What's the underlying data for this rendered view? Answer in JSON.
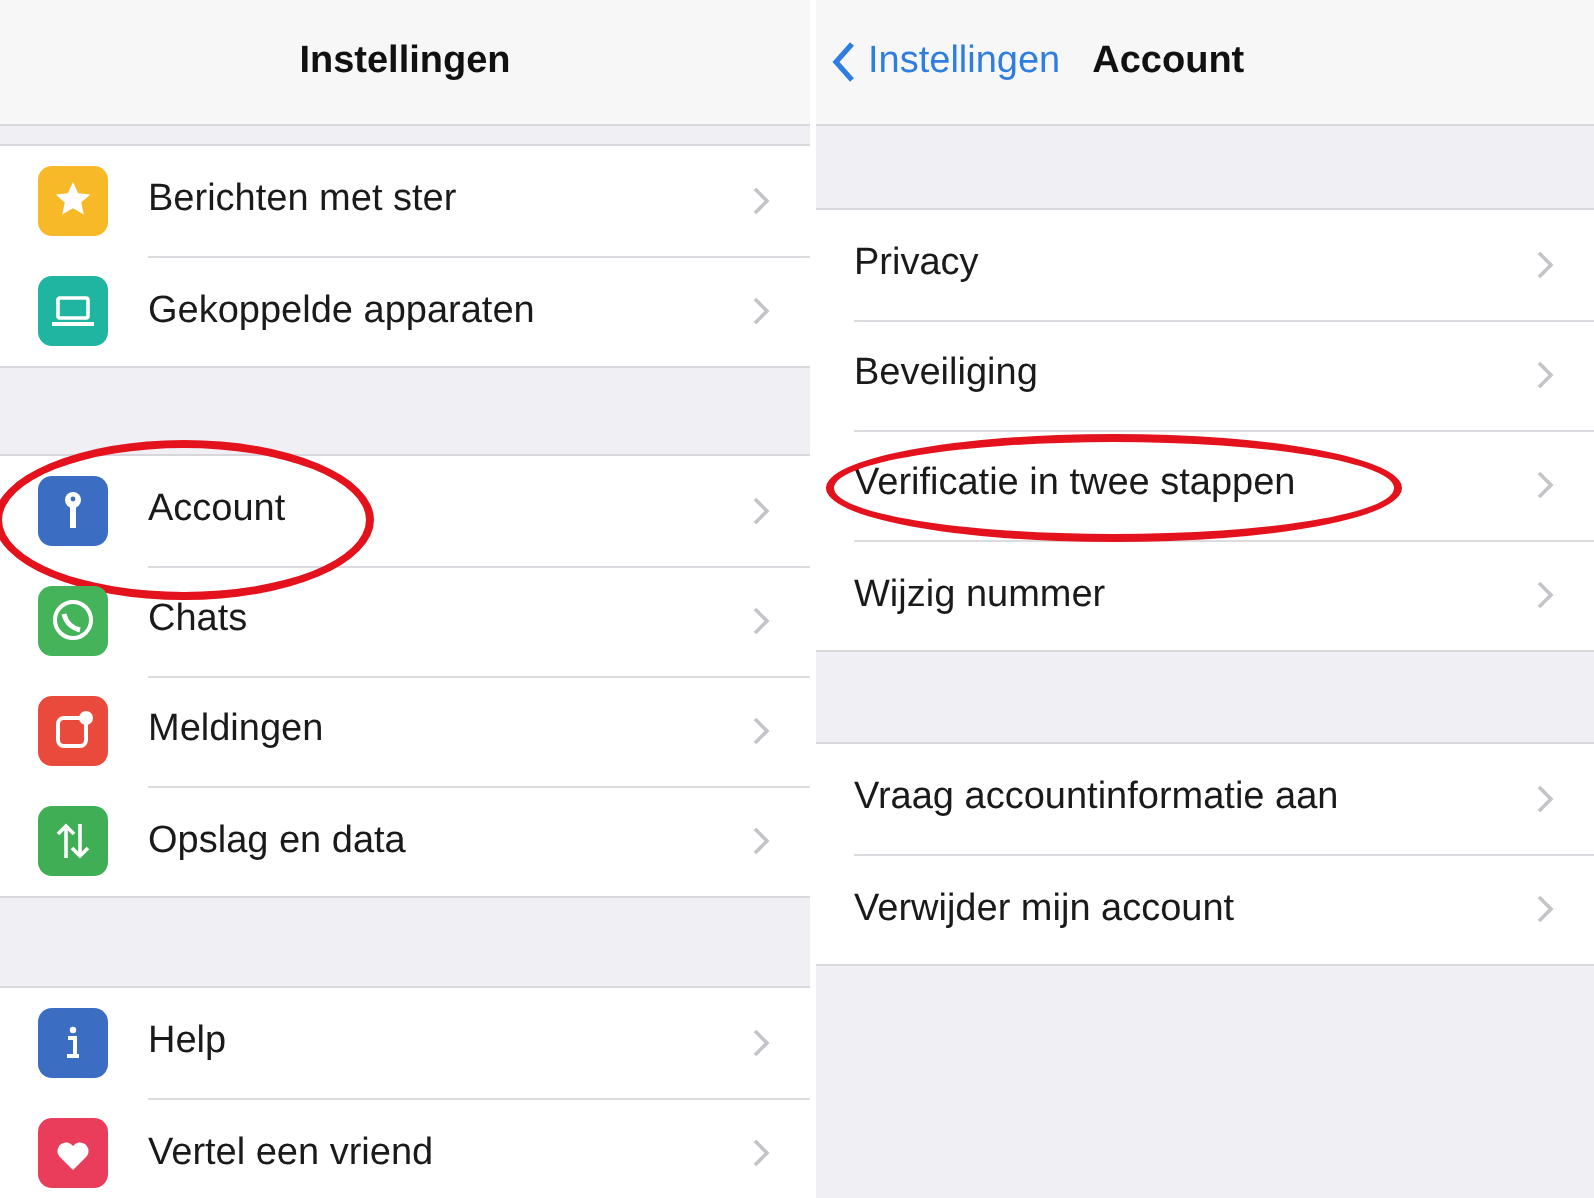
{
  "panes": [
    {
      "title": "Instellingen",
      "groups": [
        [
          {
            "label": "Berichten met ster",
            "kind": "star",
            "color": "#f7b928",
            "highlighted": false
          },
          {
            "label": "Gekoppelde apparaten",
            "kind": "laptop",
            "color": "#1fb5a0",
            "highlighted": false
          }
        ],
        [
          {
            "label": "Account",
            "kind": "key",
            "color": "#3b6dc2",
            "highlighted": true
          },
          {
            "label": "Chats",
            "kind": "chat",
            "color": "#45b35a",
            "highlighted": false
          },
          {
            "label": "Meldingen",
            "kind": "bell",
            "color": "#ea4a3c",
            "highlighted": false
          },
          {
            "label": "Opslag en data",
            "kind": "arrows",
            "color": "#3fae54",
            "highlighted": false
          }
        ],
        [
          {
            "label": "Help",
            "kind": "info",
            "color": "#3b6dc2",
            "highlighted": false
          },
          {
            "label": "Vertel een vriend",
            "kind": "heart",
            "color": "#ea3d5c",
            "highlighted": false
          }
        ]
      ]
    },
    {
      "title": "Account",
      "back": "Instellingen",
      "groups": [
        [
          {
            "label": "Privacy",
            "highlighted": false
          },
          {
            "label": "Beveiliging",
            "highlighted": false
          },
          {
            "label": "Verificatie in twee stappen",
            "highlighted": true
          },
          {
            "label": "Wijzig nummer",
            "highlighted": false
          }
        ],
        [
          {
            "label": "Vraag accountinformatie aan",
            "highlighted": false
          },
          {
            "label": "Verwijder mijn account",
            "highlighted": false
          }
        ]
      ]
    }
  ]
}
